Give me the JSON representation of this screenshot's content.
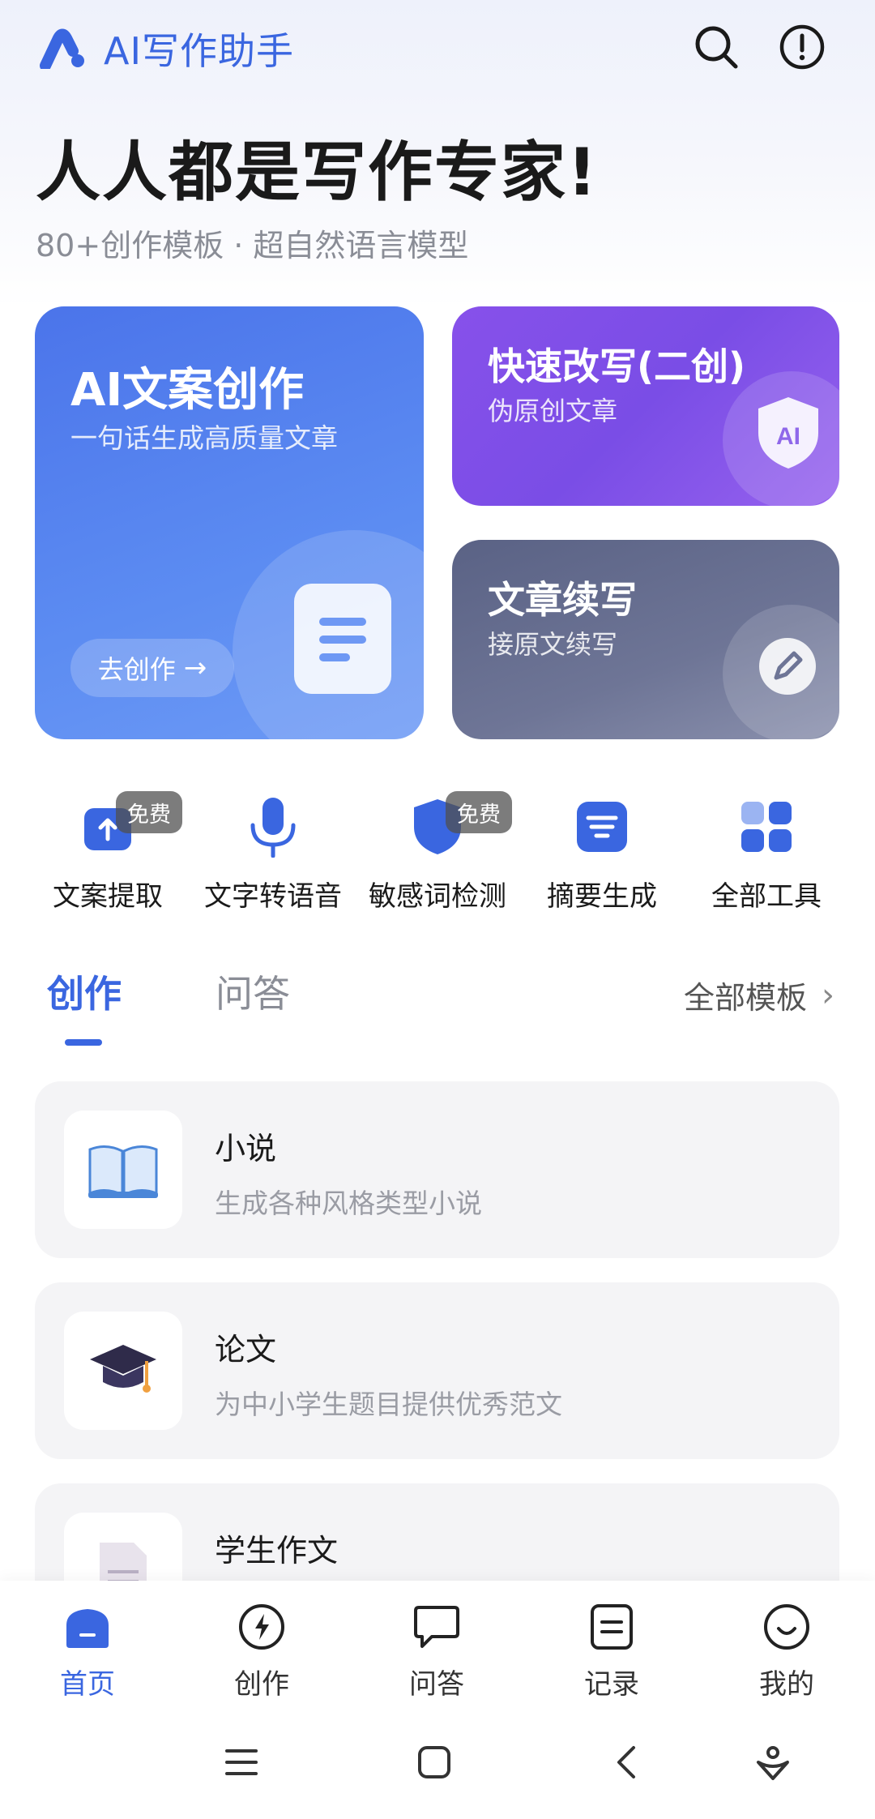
{
  "header": {
    "app_title": "AI写作助手",
    "search_icon": "search-icon",
    "info_icon": "info-icon"
  },
  "hero": {
    "title": "人人都是写作专家!",
    "subtitle": "80+创作模板 · 超自然语言模型"
  },
  "cards": {
    "main": {
      "title": "AI文案创作",
      "desc": "一句话生成高质量文章",
      "button_label": "去创作",
      "icon": "document-icon"
    },
    "rewrite": {
      "title": "快速改写(二创)",
      "desc": "伪原创文章",
      "icon": "ai-shield-icon",
      "icon_text": "AI"
    },
    "continue": {
      "title": "文章续写",
      "desc": "接原文续写",
      "icon": "pencil-icon"
    }
  },
  "tools": [
    {
      "label": "文案提取",
      "badge": "免费",
      "icon": "upload-icon"
    },
    {
      "label": "文字转语音",
      "badge": "",
      "icon": "microphone-icon"
    },
    {
      "label": "敏感词检测",
      "badge": "免费",
      "icon": "shield-icon"
    },
    {
      "label": "摘要生成",
      "badge": "",
      "icon": "summary-icon"
    },
    {
      "label": "全部工具",
      "badge": "",
      "icon": "grid-icon"
    }
  ],
  "tabs": {
    "create": "创作",
    "qa": "问答",
    "all_templates": "全部模板"
  },
  "templates": [
    {
      "title": "小说",
      "desc": "生成各种风格类型小说",
      "icon": "book-icon"
    },
    {
      "title": "论文",
      "desc": "为中小学生题目提供优秀范文",
      "icon": "graduation-cap-icon"
    },
    {
      "title": "学生作文",
      "desc": "",
      "icon": "paper-icon"
    }
  ],
  "bottom_nav": [
    {
      "label": "首页",
      "icon": "home-icon",
      "active": true
    },
    {
      "label": "创作",
      "icon": "lightning-icon",
      "active": false
    },
    {
      "label": "问答",
      "icon": "chat-icon",
      "active": false
    },
    {
      "label": "记录",
      "icon": "record-icon",
      "active": false
    },
    {
      "label": "我的",
      "icon": "smile-icon",
      "active": false
    }
  ],
  "colors": {
    "accent": "#3a66e0",
    "card_main": "#4b74ea",
    "card_rewrite": "#8751ea",
    "card_continue": "#5a6285"
  }
}
